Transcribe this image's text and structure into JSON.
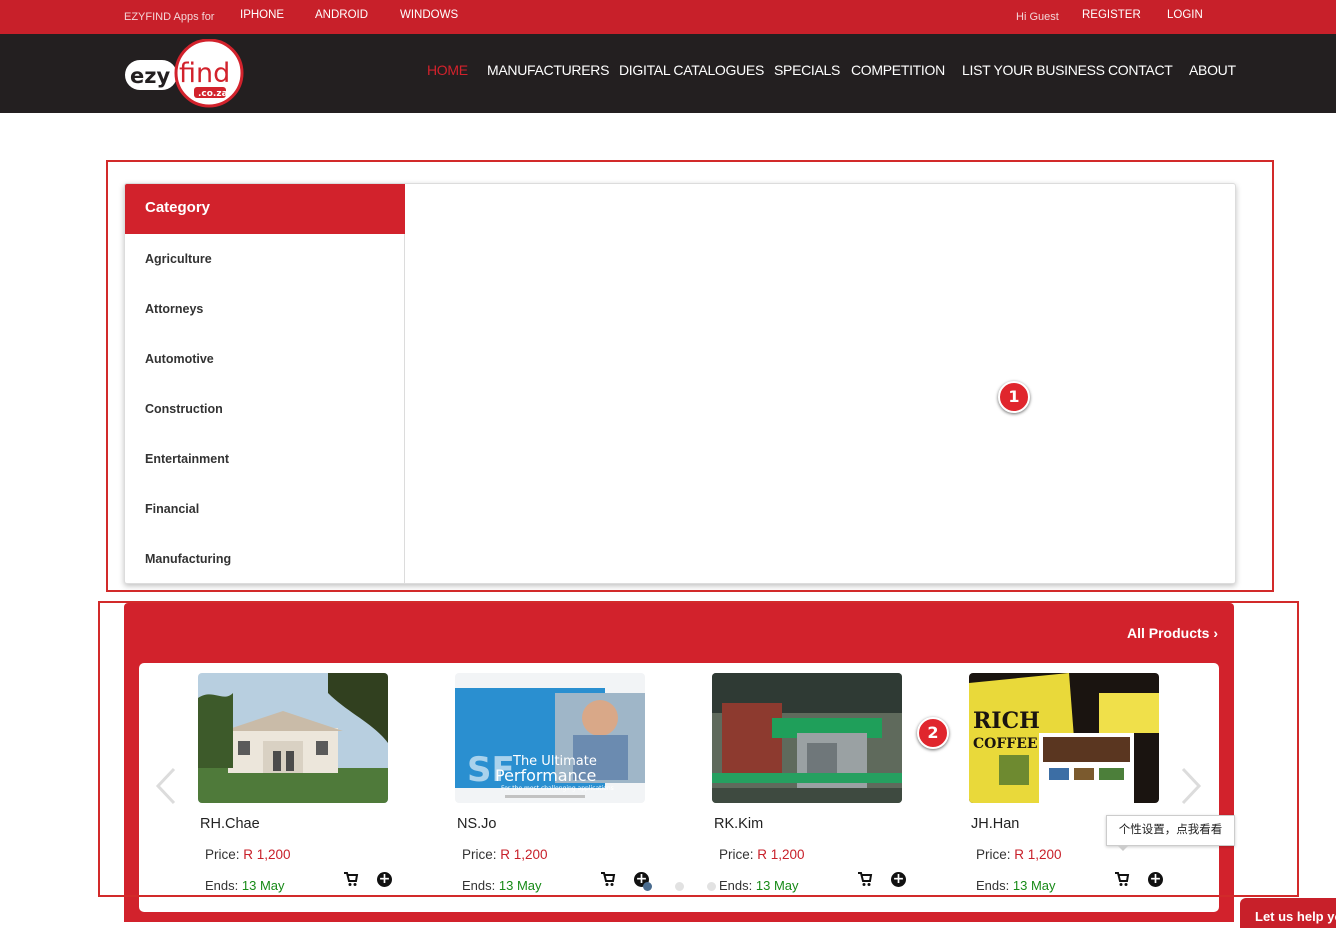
{
  "topbar": {
    "apps_label": "EZYFIND Apps for",
    "links": [
      "IPHONE",
      "ANDROID",
      "WINDOWS"
    ],
    "greeting": "Hi Guest",
    "register": "REGISTER",
    "login": "LOGIN"
  },
  "logo": {
    "part1": "ezy",
    "part2": "find",
    "domain": ".co.za"
  },
  "nav": [
    "HOME",
    "MANUFACTURERS",
    "DIGITAL CATALOGUES",
    "SPECIALS",
    "COMPETITION",
    "LIST YOUR BUSINESS",
    "CONTACT",
    "ABOUT"
  ],
  "category": {
    "title": "Category",
    "items": [
      "Agriculture",
      "Attorneys",
      "Automotive",
      "Construction",
      "Entertainment",
      "Financial",
      "Manufacturing"
    ]
  },
  "markers": [
    "1",
    "2"
  ],
  "products": {
    "all_label": "All Products",
    "price_label": "Price:",
    "ends_label": "Ends:",
    "items": [
      {
        "name": "RH.Chae",
        "price": "R 1,200",
        "ends": "13 May"
      },
      {
        "name": "NS.Jo",
        "price": "R 1,200",
        "ends": "13 May"
      },
      {
        "name": "RK.Kim",
        "price": "R 1,200",
        "ends": "13 May"
      },
      {
        "name": "JH.Han",
        "price": "R 1,200",
        "ends": "13 May"
      }
    ],
    "thumb2_text": {
      "line1": "The Ultimate",
      "line2": "Performance",
      "line3": "For the most challenging applications"
    },
    "thumb4_text": {
      "brand": "RICH",
      "sub": "COFFEE"
    }
  },
  "tooltip": "个性设置，点我看看",
  "help_button": "Let us help you",
  "colors": {
    "brand_red": "#d2222c",
    "dark": "#231f20",
    "price_red": "#c8202a",
    "ends_green": "#178a17"
  }
}
